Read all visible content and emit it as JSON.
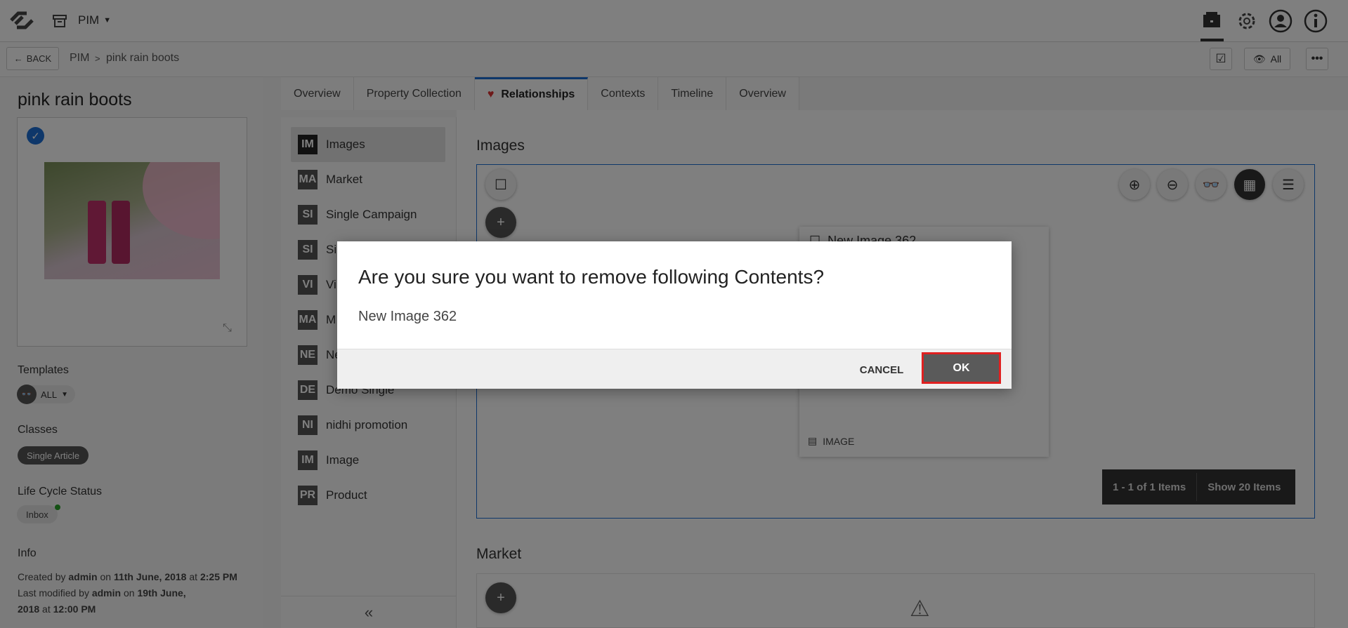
{
  "header": {
    "module": "PIM",
    "icons": [
      "logo-icon",
      "archive-icon",
      "dropdown-icon",
      "notification-box-icon",
      "gear-icon",
      "user-icon",
      "info-icon"
    ]
  },
  "breadcrumb": {
    "back_label": "BACK",
    "items": [
      "PIM",
      "pink rain boots"
    ],
    "separator": ">",
    "view_label": "All"
  },
  "product": {
    "title": "pink rain boots",
    "templates_label": "Templates",
    "templates_value": "ALL",
    "classes_label": "Classes",
    "classes_value": "Single Article",
    "lifecycle_label": "Life Cycle Status",
    "lifecycle_value": "Inbox",
    "info_label": "Info",
    "created_pre": "Created by",
    "created_user": "admin",
    "created_on": "on",
    "created_date": "11th June, 2018",
    "created_at": "at",
    "created_time": "2:25 PM",
    "modified_pre": "Last modified by",
    "modified_user": "admin",
    "modified_on": "on",
    "modified_date_1": "19th June,",
    "modified_date_2": "2018",
    "modified_at": "at",
    "modified_time": "12:00 PM"
  },
  "tabs": [
    "Overview",
    "Property Collection",
    "Relationships",
    "Contexts",
    "Timeline",
    "Overview"
  ],
  "relationships": [
    {
      "code": "IM",
      "label": "Images"
    },
    {
      "code": "MA",
      "label": "Market"
    },
    {
      "code": "SI",
      "label": "Single Campaign"
    },
    {
      "code": "SI",
      "label": "Si"
    },
    {
      "code": "VI",
      "label": "Vi"
    },
    {
      "code": "MA",
      "label": "M"
    },
    {
      "code": "NE",
      "label": "Ne"
    },
    {
      "code": "DE",
      "label": "Demo Single"
    },
    {
      "code": "NI",
      "label": "nidhi promotion"
    },
    {
      "code": "IM",
      "label": "Image"
    },
    {
      "code": "PR",
      "label": "Product"
    }
  ],
  "images_section": {
    "heading": "Images",
    "card_title": "New Image 362",
    "card_type": "IMAGE",
    "pager_range": "1 - 1 of 1 Items",
    "pager_show": "Show 20 Items"
  },
  "market_section": {
    "heading": "Market"
  },
  "dialog": {
    "title": "Are you sure you want to remove following Contents?",
    "item": "New Image 362",
    "cancel_label": "CANCEL",
    "ok_label": "OK"
  },
  "colors": {
    "accent": "#1d6fd4",
    "highlight": "#e02020",
    "ok_button": "#5a5a5a"
  }
}
